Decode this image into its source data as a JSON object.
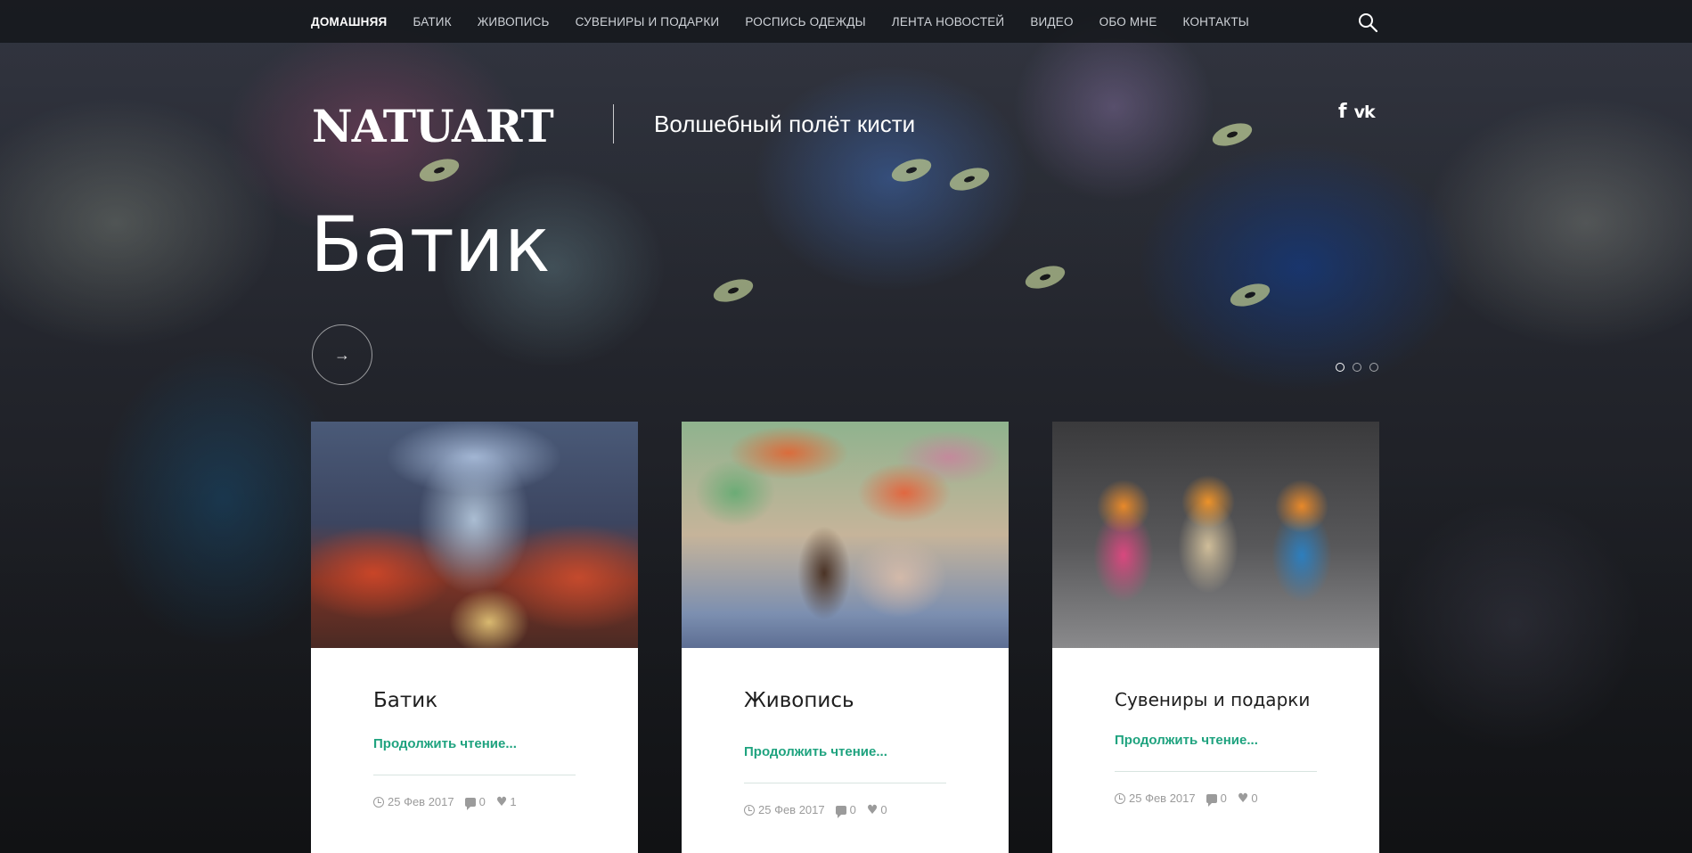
{
  "nav": {
    "items": [
      {
        "label": "ДОМАШНЯЯ",
        "active": true
      },
      {
        "label": "БАТИК"
      },
      {
        "label": "ЖИВОПИСЬ"
      },
      {
        "label": "СУВЕНИРЫ И ПОДАРКИ"
      },
      {
        "label": "РОСПИСЬ ОДЕЖДЫ"
      },
      {
        "label": "ЛЕНТА НОВОСТЕЙ"
      },
      {
        "label": "ВИДЕО"
      },
      {
        "label": "ОБО МНЕ"
      },
      {
        "label": "КОНТАКТЫ"
      }
    ],
    "search_icon": "search-icon"
  },
  "header": {
    "brand": "NATUART",
    "tagline": "Волшебный полёт кисти",
    "social": {
      "facebook": "f",
      "vk": "vk"
    }
  },
  "hero": {
    "title": "Батик",
    "next_icon": "→",
    "slides": 3,
    "active_slide": 1
  },
  "cards": [
    {
      "title": "Батик",
      "link": "Продолжить чтение...",
      "date": "25 Фев 2017",
      "comments": "0",
      "likes": "1",
      "image": "batik-artwork"
    },
    {
      "title": "Живопись",
      "link": "Продолжить чтение...",
      "date": "25 Фев 2017",
      "comments": "0",
      "likes": "0",
      "image": "still-life-painting"
    },
    {
      "title": "Сувениры и подарки",
      "link": "Продолжить чтение...",
      "date": "25 Фев 2017",
      "comments": "0",
      "likes": "0",
      "image": "felt-owls-souvenirs"
    }
  ],
  "colors": {
    "accent": "#1fa37f",
    "nav_bg": "#14161a",
    "meta": "#9b9b9b"
  }
}
